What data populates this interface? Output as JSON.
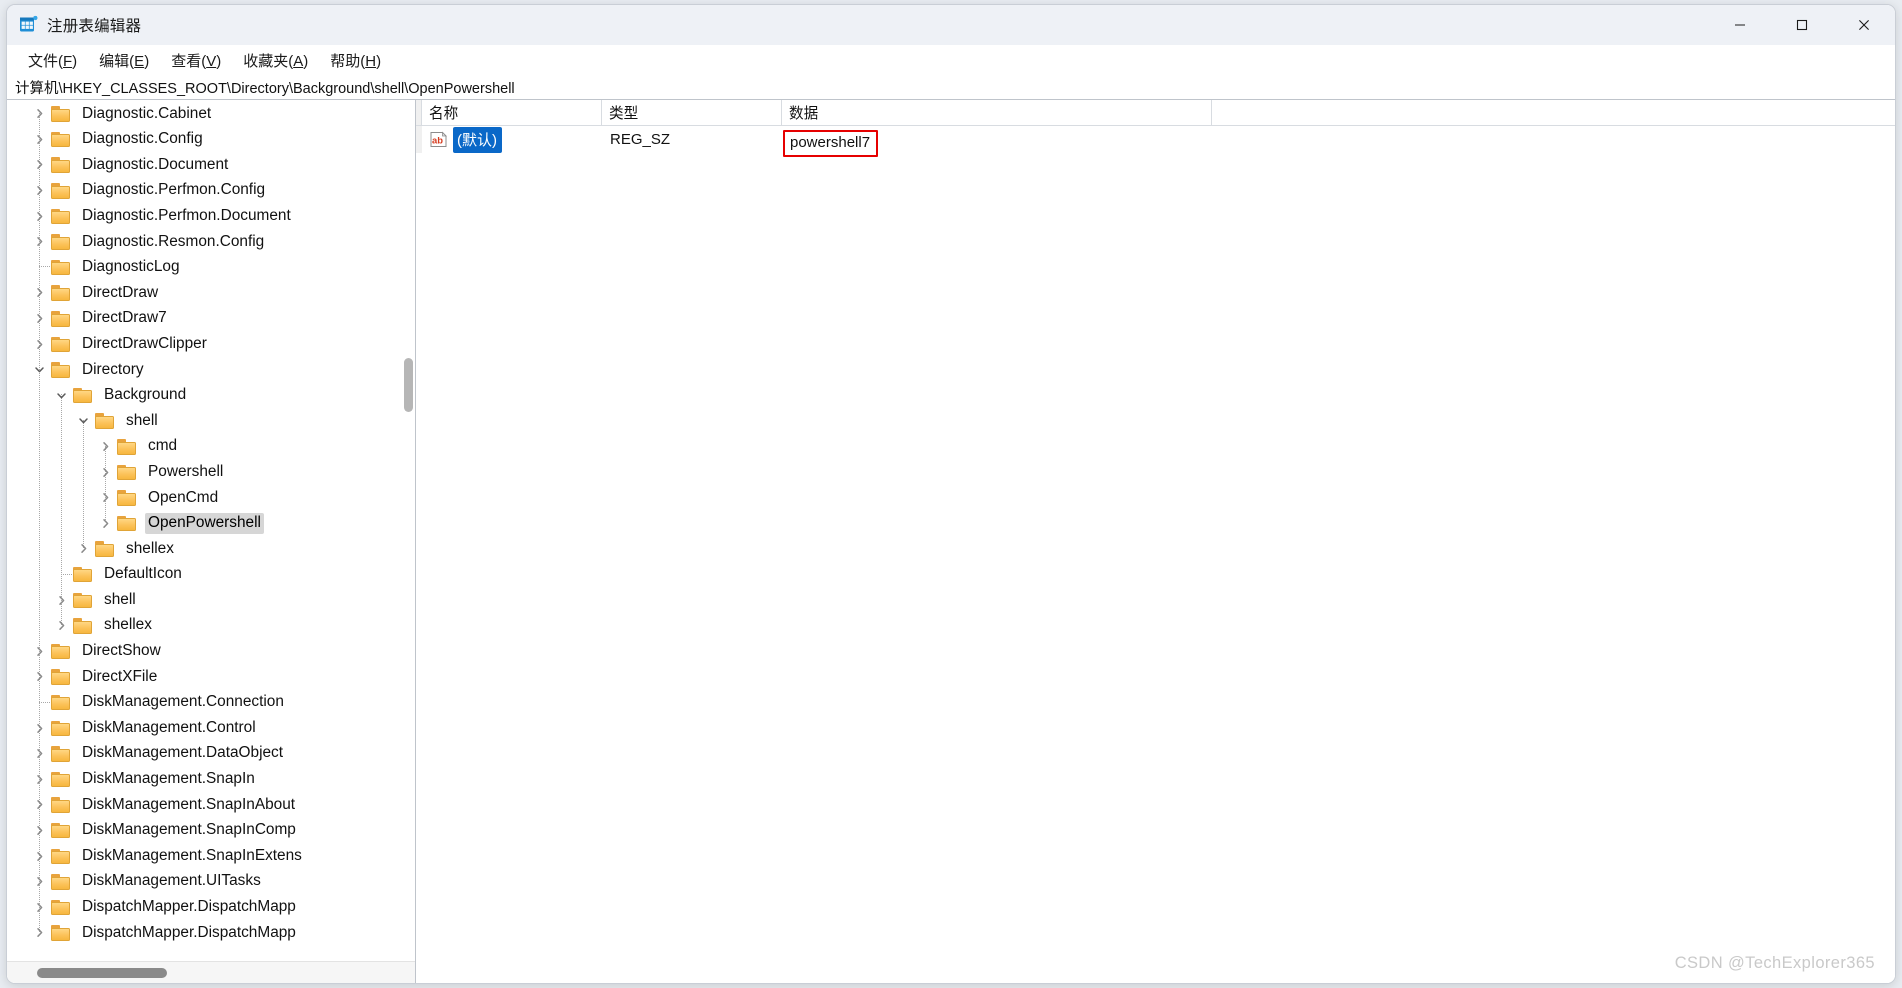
{
  "window": {
    "title": "注册表编辑器",
    "app_icon": "registry-editor-icon",
    "minimize_label": "最小化",
    "maximize_label": "最大化",
    "close_label": "关闭"
  },
  "menubar": {
    "items": [
      {
        "name": "file",
        "label": "文件(F)",
        "text": "文件(",
        "accel": "F",
        "tail": ")"
      },
      {
        "name": "edit",
        "label": "编辑(E)",
        "text": "编辑(",
        "accel": "E",
        "tail": ")"
      },
      {
        "name": "view",
        "label": "查看(V)",
        "text": "查看(",
        "accel": "V",
        "tail": ")"
      },
      {
        "name": "favorites",
        "label": "收藏夹(A)",
        "text": "收藏夹(",
        "accel": "A",
        "tail": ")"
      },
      {
        "name": "help",
        "label": "帮助(H)",
        "text": "帮助(",
        "accel": "H",
        "tail": ")"
      }
    ]
  },
  "address": {
    "path": "计算机\\HKEY_CLASSES_ROOT\\Directory\\Background\\shell\\OpenPowershell"
  },
  "tree": {
    "items": [
      {
        "label": "Diagnostic.Cabinet",
        "depth": 1,
        "expandable": true,
        "expanded": false,
        "selected": false
      },
      {
        "label": "Diagnostic.Config",
        "depth": 1,
        "expandable": true,
        "expanded": false,
        "selected": false
      },
      {
        "label": "Diagnostic.Document",
        "depth": 1,
        "expandable": true,
        "expanded": false,
        "selected": false
      },
      {
        "label": "Diagnostic.Perfmon.Config",
        "depth": 1,
        "expandable": true,
        "expanded": false,
        "selected": false
      },
      {
        "label": "Diagnostic.Perfmon.Document",
        "depth": 1,
        "expandable": true,
        "expanded": false,
        "selected": false
      },
      {
        "label": "Diagnostic.Resmon.Config",
        "depth": 1,
        "expandable": true,
        "expanded": false,
        "selected": false
      },
      {
        "label": "DiagnosticLog",
        "depth": 1,
        "expandable": false,
        "expanded": false,
        "selected": false
      },
      {
        "label": "DirectDraw",
        "depth": 1,
        "expandable": true,
        "expanded": false,
        "selected": false
      },
      {
        "label": "DirectDraw7",
        "depth": 1,
        "expandable": true,
        "expanded": false,
        "selected": false
      },
      {
        "label": "DirectDrawClipper",
        "depth": 1,
        "expandable": true,
        "expanded": false,
        "selected": false
      },
      {
        "label": "Directory",
        "depth": 1,
        "expandable": true,
        "expanded": true,
        "selected": false
      },
      {
        "label": "Background",
        "depth": 2,
        "expandable": true,
        "expanded": true,
        "selected": false
      },
      {
        "label": "shell",
        "depth": 3,
        "expandable": true,
        "expanded": true,
        "selected": false
      },
      {
        "label": "cmd",
        "depth": 4,
        "expandable": true,
        "expanded": false,
        "selected": false
      },
      {
        "label": "Powershell",
        "depth": 4,
        "expandable": true,
        "expanded": false,
        "selected": false
      },
      {
        "label": "OpenCmd",
        "depth": 4,
        "expandable": true,
        "expanded": false,
        "selected": false
      },
      {
        "label": "OpenPowershell",
        "depth": 4,
        "expandable": true,
        "expanded": false,
        "selected": true
      },
      {
        "label": "shellex",
        "depth": 3,
        "expandable": true,
        "expanded": false,
        "selected": false
      },
      {
        "label": "DefaultIcon",
        "depth": 2,
        "expandable": false,
        "expanded": false,
        "selected": false
      },
      {
        "label": "shell",
        "depth": 2,
        "expandable": true,
        "expanded": false,
        "selected": false
      },
      {
        "label": "shellex",
        "depth": 2,
        "expandable": true,
        "expanded": false,
        "selected": false
      },
      {
        "label": "DirectShow",
        "depth": 1,
        "expandable": true,
        "expanded": false,
        "selected": false
      },
      {
        "label": "DirectXFile",
        "depth": 1,
        "expandable": true,
        "expanded": false,
        "selected": false
      },
      {
        "label": "DiskManagement.Connection",
        "depth": 1,
        "expandable": false,
        "expanded": false,
        "selected": false
      },
      {
        "label": "DiskManagement.Control",
        "depth": 1,
        "expandable": true,
        "expanded": false,
        "selected": false
      },
      {
        "label": "DiskManagement.DataObject",
        "depth": 1,
        "expandable": true,
        "expanded": false,
        "selected": false
      },
      {
        "label": "DiskManagement.SnapIn",
        "depth": 1,
        "expandable": true,
        "expanded": false,
        "selected": false
      },
      {
        "label": "DiskManagement.SnapInAbout",
        "depth": 1,
        "expandable": true,
        "expanded": false,
        "selected": false
      },
      {
        "label": "DiskManagement.SnapInComp",
        "depth": 1,
        "expandable": true,
        "expanded": false,
        "selected": false
      },
      {
        "label": "DiskManagement.SnapInExtens",
        "depth": 1,
        "expandable": true,
        "expanded": false,
        "selected": false
      },
      {
        "label": "DiskManagement.UITasks",
        "depth": 1,
        "expandable": true,
        "expanded": false,
        "selected": false
      },
      {
        "label": "DispatchMapper.DispatchMapp",
        "depth": 1,
        "expandable": true,
        "expanded": false,
        "selected": false
      },
      {
        "label": "DispatchMapper.DispatchMapp",
        "depth": 1,
        "expandable": true,
        "expanded": false,
        "selected": false
      }
    ]
  },
  "list": {
    "columns": [
      {
        "name": "name",
        "label": "名称"
      },
      {
        "name": "type",
        "label": "类型"
      },
      {
        "name": "data",
        "label": "数据"
      }
    ],
    "rows": [
      {
        "icon": "ab-string-value-icon",
        "name": "(默认)",
        "type": "REG_SZ",
        "data": "powershell7",
        "selected": true,
        "highlighted": true
      }
    ]
  },
  "annotation": {
    "highlight_color": "#e60000"
  },
  "watermark": {
    "text": "CSDN @TechExplorer365"
  }
}
